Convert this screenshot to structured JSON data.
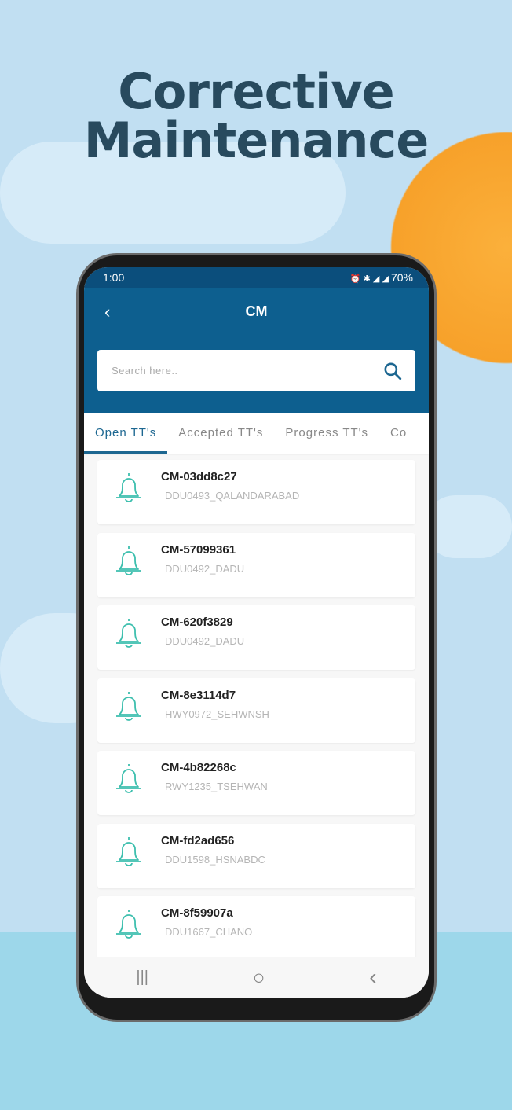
{
  "headline": {
    "line1": "Corrective",
    "line2": "Maintenance"
  },
  "colors": {
    "appbar": "#0d5f8f",
    "accent": "#1d6791",
    "bell": "#3dbfae",
    "sun": "#f7a12a"
  },
  "status_bar": {
    "time": "1:00",
    "battery": "70%"
  },
  "app_bar": {
    "title": "CM",
    "back_icon": "chevron-left-icon"
  },
  "search": {
    "placeholder": "Search here..",
    "value": "",
    "icon": "search-icon"
  },
  "tabs": [
    {
      "label": "Open TT's",
      "active": true
    },
    {
      "label": "Accepted TT's"
    },
    {
      "label": "Progress TT's"
    },
    {
      "label": "Co"
    }
  ],
  "tickets": [
    {
      "id": "CM-03dd8c27",
      "site": "DDU0493_QALANDARABAD"
    },
    {
      "id": "CM-57099361",
      "site": "DDU0492_DADU"
    },
    {
      "id": "CM-620f3829",
      "site": "DDU0492_DADU"
    },
    {
      "id": "CM-8e3114d7",
      "site": "HWY0972_SEHWNSH"
    },
    {
      "id": "CM-4b82268c",
      "site": "RWY1235_TSEHWAN"
    },
    {
      "id": "CM-fd2ad656",
      "site": "DDU1598_HSNABDC"
    },
    {
      "id": "CM-8f59907a",
      "site": "DDU1667_CHANO"
    }
  ],
  "nav": {
    "recents": "|||",
    "home": "○",
    "back": "‹"
  }
}
